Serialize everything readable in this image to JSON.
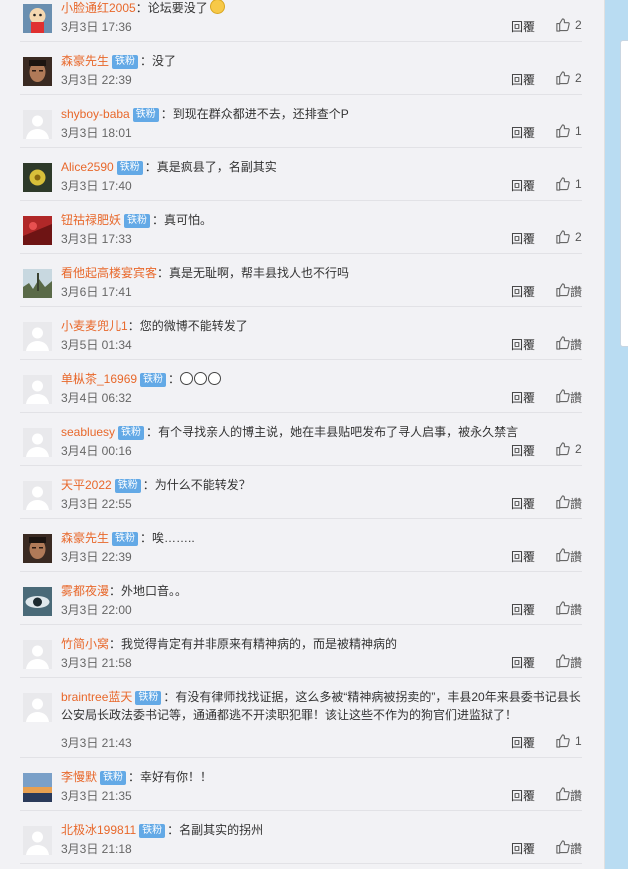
{
  "comments": [
    {
      "user": "小脸通红2005",
      "text": "论坛要没了",
      "emoji": "smile",
      "time": "3月3日 17:36",
      "reply": "回覆",
      "likes": "2",
      "avatar": "cartoon",
      "tall": false
    },
    {
      "user": "森豪先生",
      "badge": "铁粉",
      "text": "没了",
      "time": "3月3日 22:39",
      "reply": "回覆",
      "likes": "2",
      "avatar": "face",
      "tall": false
    },
    {
      "user": "shyboy-baba",
      "badge": "铁粉",
      "text": "到现在群众都进不去，还排查个P",
      "time": "3月3日 18:01",
      "reply": "回覆",
      "likes": "1",
      "avatar": "default",
      "tall": false
    },
    {
      "user": "Alice2590",
      "badge": "铁粉",
      "text": "真是疯县了，名副其实",
      "time": "3月3日 17:40",
      "reply": "回覆",
      "likes": "1",
      "avatar": "flower",
      "tall": false
    },
    {
      "user": "钮祜禄肥妖",
      "badge": "铁粉",
      "text": "真可怕。",
      "time": "3月3日 17:33",
      "reply": "回覆",
      "likes": "2",
      "avatar": "red",
      "tall": false
    },
    {
      "user": "看他起高楼宴宾客",
      "text": "真是无耻啊，帮丰县找人也不行吗",
      "time": "3月6日 17:41",
      "reply": "回覆",
      "likes": "讚",
      "avatar": "tree",
      "tall": false
    },
    {
      "user": "小麦麦兜儿1",
      "text": "您的微博不能转发了",
      "time": "3月5日 01:34",
      "reply": "回覆",
      "likes": "讚",
      "avatar": "default",
      "tall": false
    },
    {
      "user": "单枞茶_16969",
      "badge": "铁粉",
      "text": "",
      "emoji": "sad3",
      "time": "3月4日 06:32",
      "reply": "回覆",
      "likes": "讚",
      "avatar": "default",
      "tall": false
    },
    {
      "user": "seabluesy",
      "badge": "铁粉",
      "text": "有个寻找亲人的博主说，她在丰县贴吧发布了寻人启事，被永久禁言",
      "time": "3月4日 00:16",
      "reply": "回覆",
      "likes": "2",
      "avatar": "default",
      "tall": false
    },
    {
      "user": "天平2022",
      "badge": "铁粉",
      "text": "为什么不能转发？",
      "time": "3月3日 22:55",
      "reply": "回覆",
      "likes": "讚",
      "avatar": "default",
      "tall": false
    },
    {
      "user": "森豪先生",
      "badge": "铁粉",
      "text": "唉……..",
      "time": "3月3日 22:39",
      "reply": "回覆",
      "likes": "讚",
      "avatar": "face",
      "tall": false
    },
    {
      "user": "雾都夜漫",
      "text": "外地口音。。",
      "time": "3月3日 22:00",
      "reply": "回覆",
      "likes": "讚",
      "avatar": "eye",
      "tall": false
    },
    {
      "user": "竹简小窝",
      "text": "我觉得肯定有并非原来有精神病的，而是被精神病的",
      "time": "3月3日 21:58",
      "reply": "回覆",
      "likes": "讚",
      "avatar": "default",
      "tall": false
    },
    {
      "user": "braintree蓝天",
      "badge": "铁粉",
      "text": "有没有律师找找证据，这么多被“精神病被拐卖的”，丰县20年来县委书记县长公安局长政法委书记等，通通都逃不开渎职犯罪！该让这些不作为的狗官们进监狱了！",
      "time": "3月3日 21:43",
      "reply": "回覆",
      "likes": "1",
      "avatar": "default",
      "tall": true
    },
    {
      "user": "李慢默",
      "badge": "铁粉",
      "text": "幸好有你！！",
      "time": "3月3日 21:35",
      "reply": "回覆",
      "likes": "讚",
      "avatar": "sunset",
      "tall": false
    },
    {
      "user": "北极冰199811",
      "badge": "铁粉",
      "text": "名副其实的拐州",
      "time": "3月3日 21:18",
      "reply": "回覆",
      "likes": "讚",
      "avatar": "default",
      "tall": false
    }
  ],
  "colon": "："
}
